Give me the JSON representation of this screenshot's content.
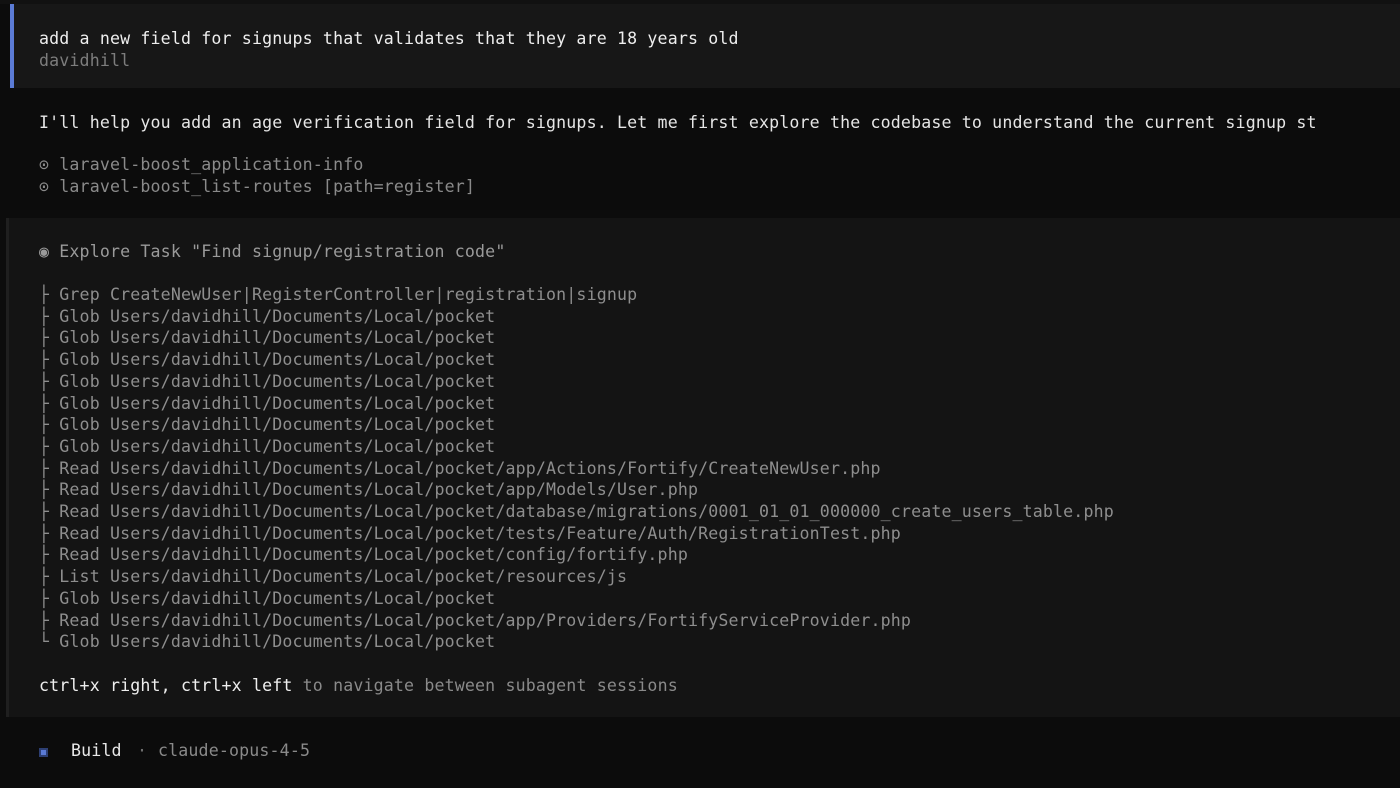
{
  "user_message": {
    "prompt": "add a new field for signups that validates that they are 18 years old",
    "author": "davidhill"
  },
  "assistant": {
    "reply": "I'll help you add an age verification field for signups. Let me first explore the codebase to understand the current signup st",
    "tool_calls": [
      {
        "symbol": "⊙",
        "label": "laravel-boost_application-info"
      },
      {
        "symbol": "⊙",
        "label": "laravel-boost_list-routes [path=register]"
      }
    ]
  },
  "task": {
    "symbol": "◉",
    "title": "Explore Task \"Find signup/registration code\"",
    "steps": [
      {
        "branch": "├",
        "text": "Grep CreateNewUser|RegisterController|registration|signup"
      },
      {
        "branch": "├",
        "text": "Glob Users/davidhill/Documents/Local/pocket"
      },
      {
        "branch": "├",
        "text": "Glob Users/davidhill/Documents/Local/pocket"
      },
      {
        "branch": "├",
        "text": "Glob Users/davidhill/Documents/Local/pocket"
      },
      {
        "branch": "├",
        "text": "Glob Users/davidhill/Documents/Local/pocket"
      },
      {
        "branch": "├",
        "text": "Glob Users/davidhill/Documents/Local/pocket"
      },
      {
        "branch": "├",
        "text": "Glob Users/davidhill/Documents/Local/pocket"
      },
      {
        "branch": "├",
        "text": "Glob Users/davidhill/Documents/Local/pocket"
      },
      {
        "branch": "├",
        "text": "Read Users/davidhill/Documents/Local/pocket/app/Actions/Fortify/CreateNewUser.php"
      },
      {
        "branch": "├",
        "text": "Read Users/davidhill/Documents/Local/pocket/app/Models/User.php"
      },
      {
        "branch": "├",
        "text": "Read Users/davidhill/Documents/Local/pocket/database/migrations/0001_01_01_000000_create_users_table.php"
      },
      {
        "branch": "├",
        "text": "Read Users/davidhill/Documents/Local/pocket/tests/Feature/Auth/RegistrationTest.php"
      },
      {
        "branch": "├",
        "text": "Read Users/davidhill/Documents/Local/pocket/config/fortify.php"
      },
      {
        "branch": "├",
        "text": "List Users/davidhill/Documents/Local/pocket/resources/js"
      },
      {
        "branch": "├",
        "text": "Glob Users/davidhill/Documents/Local/pocket"
      },
      {
        "branch": "├",
        "text": "Read Users/davidhill/Documents/Local/pocket/app/Providers/FortifyServiceProvider.php"
      },
      {
        "branch": "└",
        "text": "Glob Users/davidhill/Documents/Local/pocket"
      }
    ],
    "nav_keys": "ctrl+x right, ctrl+x left",
    "nav_desc": "to navigate between subagent sessions"
  },
  "status_bar": {
    "mode": "Build",
    "separator": "·",
    "model": "claude-opus-4-5"
  },
  "colors": {
    "accent": "#5b7bd5",
    "background": "#0c0c0c",
    "panel": "#141414",
    "user_panel": "#171717"
  }
}
